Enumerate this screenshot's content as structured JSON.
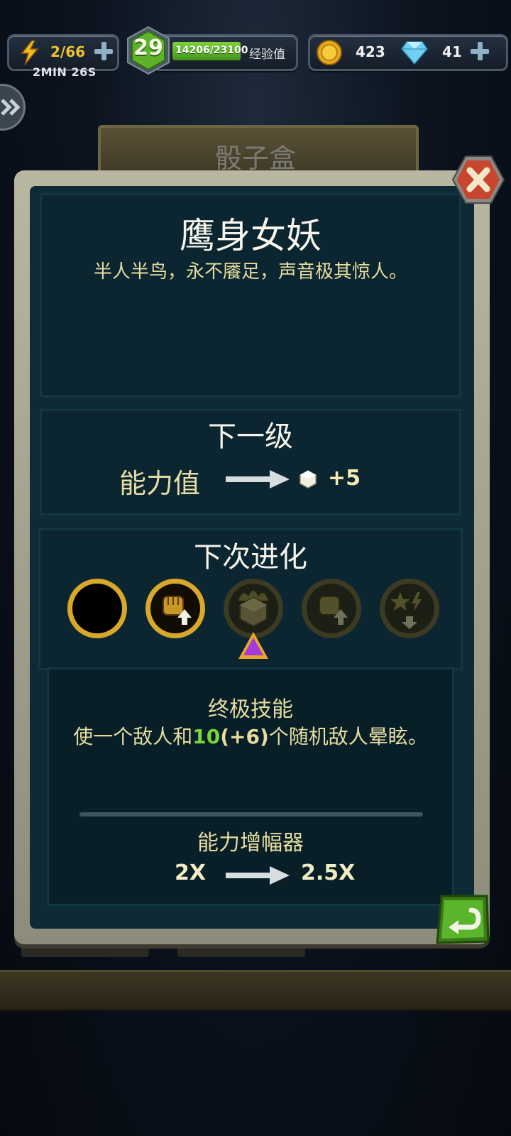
{
  "hud": {
    "energy": "2/66",
    "energy_timer": "2MIN 26S",
    "level": "29",
    "xp": "14206/23100",
    "xp_progress": 0.615,
    "xp_label": "经验值",
    "coins": "423",
    "gems": "41"
  },
  "background": {
    "header_title": "骰子盒"
  },
  "panel": {
    "title": "鹰身女妖",
    "description": "半人半鸟，永不餍足，声音极其惊人。",
    "next_level": {
      "heading": "下一级",
      "stat_label": "能力值",
      "stat_bonus": "+5"
    },
    "next_evolution": {
      "heading": "下次进化",
      "slots": [
        {
          "icon": "empty-slot-icon",
          "state": "done"
        },
        {
          "icon": "fist-up-icon",
          "state": "active"
        },
        {
          "icon": "burning-cube-icon",
          "state": "locked",
          "selected": true
        },
        {
          "icon": "fist-up-icon",
          "state": "locked"
        },
        {
          "icon": "star-bolt-down-icon",
          "state": "locked"
        }
      ]
    },
    "skill": {
      "title": "终极技能",
      "desc_prefix": "使一个敌人和",
      "desc_value": "10",
      "desc_bonus": "(+6)",
      "desc_suffix": "个随机敌人晕眩。"
    },
    "amplifier": {
      "title": "能力增幅器",
      "from": "2X",
      "to": "2.5X"
    }
  },
  "colors": {
    "accent_green": "#7ad53a",
    "gold": "#f2c230",
    "panel_bg": "#0e2a34",
    "close_red": "#c8452e"
  }
}
